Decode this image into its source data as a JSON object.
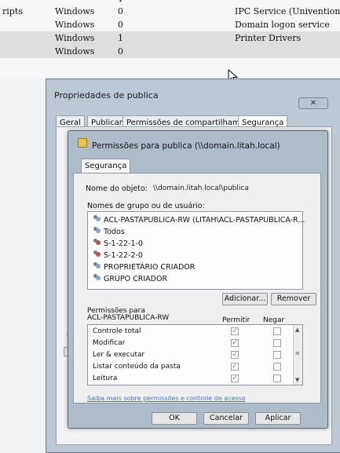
{
  "background_list": {
    "top_partial_value": "1",
    "rows": [
      {
        "name": "ripts",
        "type": "Windows",
        "count": "0",
        "description": "IPC Service (Univention ...",
        "selected": false
      },
      {
        "name": "",
        "type": "Windows",
        "count": "0",
        "description": "Domain logon service",
        "selected": false
      },
      {
        "name": "",
        "type": "Windows",
        "count": "1",
        "description": "Printer Drivers",
        "selected": true
      },
      {
        "name": "",
        "type": "Windows",
        "count": "0",
        "description": "",
        "selected": true
      }
    ]
  },
  "outer_dialog": {
    "title": "Propriedades de publica",
    "close_glyph": "✕",
    "tabs": [
      "Geral",
      "Publicar",
      "Permissões de compartilhamento",
      "Segurança"
    ],
    "active_tab": "Segurança",
    "fragments": [
      "N",
      "N",
      "P",
      "P",
      "a"
    ]
  },
  "inner_dialog": {
    "title": "Permissões para publica (\\\\domain.litah.local)",
    "tab": "Segurança",
    "object_label": "Nome do objeto:",
    "object_value": "\\\\domain.litah.local\\publica",
    "groups_label": "Nomes de grupo ou de usuário:",
    "groups": [
      {
        "name": "ACL-PASTAPUBLICA-RW (LITAH\\ACL-PASTAPUBLICA-R...",
        "icon": "group-icon"
      },
      {
        "name": "Todos",
        "icon": "group-icon"
      },
      {
        "name": "S-1-22-1-0",
        "icon": "unknown-user-icon"
      },
      {
        "name": "S-1-22-2-0",
        "icon": "unknown-user-icon"
      },
      {
        "name": "PROPRIETÁRIO CRIADOR",
        "icon": "group-icon"
      },
      {
        "name": "GRUPO CRIADOR",
        "icon": "group-icon"
      }
    ],
    "add_button": "Adicionar...",
    "remove_button": "Remover",
    "permissions_for_label": "Permissões para",
    "permissions_for_group": "ACL-PASTAPUBLICA-RW",
    "allow_header": "Permitir",
    "deny_header": "Negar",
    "permissions": [
      {
        "name": "Controle total",
        "allow": true,
        "deny": false
      },
      {
        "name": "Modificar",
        "allow": true,
        "deny": false
      },
      {
        "name": "Ler & executar",
        "allow": true,
        "deny": false
      },
      {
        "name": "Listar conteúdo da pasta",
        "allow": true,
        "deny": false
      },
      {
        "name": "Leitura",
        "allow": true,
        "deny": false
      }
    ],
    "scroll_up_glyph": "▲",
    "scroll_mid_glyph": "≡",
    "scroll_down_glyph": "▼",
    "learn_link": "Saiba mais sobre permissões e controle de acesso",
    "ok_button": "OK",
    "cancel_button": "Cancelar",
    "apply_button": "Aplicar",
    "check_glyph": "✓"
  }
}
